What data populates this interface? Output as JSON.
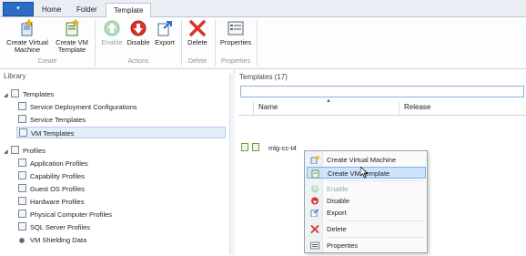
{
  "app_menu": {
    "label": ""
  },
  "tabs": [
    {
      "label": "Home"
    },
    {
      "label": "Folder"
    },
    {
      "label": "Template"
    }
  ],
  "ribbon": {
    "groups": [
      {
        "label": "Create",
        "buttons": [
          {
            "label_line1": "Create Virtual",
            "label_line2": "Machine",
            "icon": "create-vm-icon"
          },
          {
            "label_line1": "Create VM",
            "label_line2": "Template",
            "icon": "create-template-icon"
          }
        ]
      },
      {
        "label": "Actions",
        "buttons": [
          {
            "label": "Enable",
            "icon": "enable-icon",
            "disabled": true
          },
          {
            "label": "Disable",
            "icon": "disable-icon"
          },
          {
            "label": "Export",
            "icon": "export-icon"
          }
        ]
      },
      {
        "label": "Delete",
        "buttons": [
          {
            "label": "Delete",
            "icon": "delete-icon"
          }
        ]
      },
      {
        "label": "Properties",
        "buttons": [
          {
            "label": "Properties",
            "icon": "properties-icon"
          }
        ]
      }
    ]
  },
  "library": {
    "title": "Library",
    "templates_node": "Templates",
    "templates_children": [
      "Service Deployment Configurations",
      "Service Templates",
      "VM Templates"
    ],
    "profiles_node": "Profiles",
    "profiles_children": [
      "Application Profiles",
      "Capability Profiles",
      "Guest OS Profiles",
      "Hardware Profiles",
      "Physical Computer Profiles",
      "SQL Server Profiles",
      "VM Shielding Data"
    ]
  },
  "content": {
    "title": "Templates (17)",
    "columns": [
      "Name",
      "Release"
    ],
    "rows": [
      {
        "name": "mlg-cc-t4"
      }
    ]
  },
  "context_menu": {
    "items": [
      {
        "label": "Create Virtual Machine",
        "icon": "create-vm-icon"
      },
      {
        "label": "Create VM Template",
        "icon": "create-template-icon",
        "highlighted": true
      },
      {
        "label": "Enable",
        "icon": "enable-icon",
        "disabled": true
      },
      {
        "label": "Disable",
        "icon": "disable-icon"
      },
      {
        "label": "Export",
        "icon": "export-icon"
      },
      {
        "label": "Delete",
        "icon": "delete-icon"
      },
      {
        "label": "Properties",
        "icon": "properties-icon"
      }
    ]
  },
  "colors": {
    "accent": "#2b6cc4",
    "highlight": "#cde3fb",
    "delete_red": "#d9342b",
    "enable_green": "#3fa34d"
  }
}
